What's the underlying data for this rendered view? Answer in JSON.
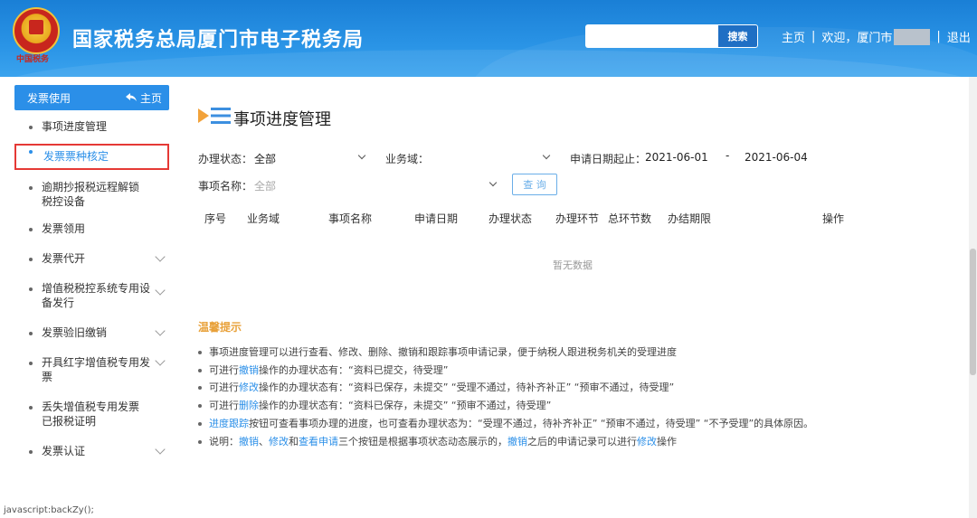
{
  "header": {
    "site_title": "国家税务总局厦门市电子税务局",
    "emblem_caption": "中国税务",
    "search_placeholder": "",
    "search_label": "搜索",
    "home_link": "主页",
    "welcome_text": "欢迎，厦门市",
    "logout_link": "退出",
    "separator": "|"
  },
  "sidebar": {
    "section_title": "发票使用",
    "home_label": "主页",
    "items": [
      {
        "label": "事项进度管理"
      },
      {
        "label": "发票票种核定"
      },
      {
        "label": "逾期抄报税远程解锁税控设备"
      },
      {
        "label": "发票领用"
      },
      {
        "label": "发票代开"
      },
      {
        "label": "增值税税控系统专用设备发行"
      },
      {
        "label": "发票验旧缴销"
      },
      {
        "label": "开具红字增值税专用发票"
      },
      {
        "label": "丢失增值税专用发票已报税证明"
      },
      {
        "label": "发票认证"
      }
    ]
  },
  "main": {
    "title": "事项进度管理",
    "filters": {
      "status_label": "办理状态：",
      "status_value": "全部",
      "domain_label": "业务域：",
      "domain_value": "",
      "date_label": "申请日期起止：",
      "date_start": "2021-06-01",
      "date_sep": "-",
      "date_end": "2021-06-04",
      "item_label": "事项名称：",
      "item_placeholder": "全部",
      "query_button": "查 询"
    },
    "table": {
      "columns": [
        "序号",
        "业务域",
        "事项名称",
        "申请日期",
        "办理状态",
        "办理环节",
        "总环节数",
        "办结期限",
        "操作"
      ],
      "empty_text": "暂无数据"
    },
    "tips": {
      "title": "温馨提示",
      "line1": "事项进度管理可以进行查看、修改、删除、撤销和跟踪事项申请记录，便于纳税人跟进税务机关的受理进度",
      "line2_pre": "可进行",
      "line2_link": "撤销",
      "line2_post": "操作的办理状态有：“资料已提交，待受理”",
      "line3_pre": "可进行",
      "line3_link": "修改",
      "line3_post": "操作的办理状态有：“资料已保存，未提交”  “受理不通过，待补齐补正”  “预审不通过，待受理”",
      "line4_pre": "可进行",
      "line4_link": "删除",
      "line4_post": "操作的办理状态有：“资料已保存，未提交”  “预审不通过，待受理”",
      "line5_link": "进度跟踪",
      "line5_post": "按钮可查看事项办理的进度，也可查看办理状态为：“受理不通过，待补齐补正”  “预审不通过，待受理”  “不予受理”的具体原因。",
      "line6_pre": "说明：",
      "line6_link1": "撤销",
      "line6_mid1": "、",
      "line6_link2": "修改",
      "line6_mid2": "和",
      "line6_link3": "查看申请",
      "line6_mid3": "三个按钮是根据事项状态动态展示的，",
      "line6_link4": "撤销",
      "line6_mid4": "之后的申请记录可以进行",
      "line6_link5": "修改",
      "line6_post": "操作"
    }
  },
  "statusbar": {
    "text": "javascript:backZy();"
  },
  "colors": {
    "header_blue": "#2a94e6",
    "accent_blue": "#2b8fe8",
    "highlight_red": "#e53935",
    "tip_orange": "#e8a13a"
  }
}
